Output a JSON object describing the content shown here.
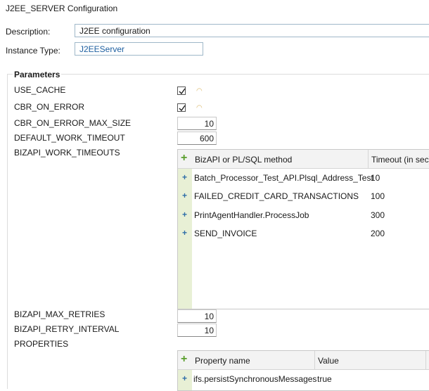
{
  "window": {
    "title": "J2EE_SERVER Configuration"
  },
  "form": {
    "description_label": "Description:",
    "description_value": "J2EE configuration",
    "instance_type_label": "Instance Type:",
    "instance_type_value": "J2EEServer"
  },
  "parameters": {
    "title": "Parameters",
    "use_cache": {
      "label": "USE_CACHE",
      "checked": true
    },
    "cbr_on_error": {
      "label": "CBR_ON_ERROR",
      "checked": true
    },
    "cbr_on_error_max_size": {
      "label": "CBR_ON_ERROR_MAX_SIZE",
      "value": "10"
    },
    "default_work_timeout": {
      "label": "DEFAULT_WORK_TIMEOUT",
      "value": "600"
    },
    "bizapi_work_timeouts": {
      "label": "BIZAPI_WORK_TIMEOUTS",
      "columns": [
        "BizAPI or PL/SQL method",
        "Timeout (in sec)"
      ],
      "rows": [
        [
          "Batch_Processor_Test_API.Plsql_Address_Test",
          "10"
        ],
        [
          "FAILED_CREDIT_CARD_TRANSACTIONS",
          "100"
        ],
        [
          "PrintAgentHandler.ProcessJob",
          "300"
        ],
        [
          "SEND_INVOICE",
          "200"
        ]
      ]
    },
    "bizapi_max_retries": {
      "label": "BIZAPI_MAX_RETRIES",
      "value": "10"
    },
    "bizapi_retry_interval": {
      "label": "BIZAPI_RETRY_INTERVAL",
      "value": "10"
    },
    "properties": {
      "label": "PROPERTIES",
      "columns": [
        "Property name",
        "Value"
      ],
      "rows": [
        [
          "ifs.persistSynchronousMessages",
          "true"
        ]
      ]
    }
  },
  "icons": {
    "add": "plus-icon",
    "row_add": "plus-icon",
    "check": "checkmark-icon",
    "default_marker": "default-value-icon"
  },
  "colors": {
    "gutter": "#e8f0d5",
    "add_green": "#5a9e2d",
    "row_plus_blue": "#2f6ea8",
    "field_border": "#9fb8c9"
  }
}
